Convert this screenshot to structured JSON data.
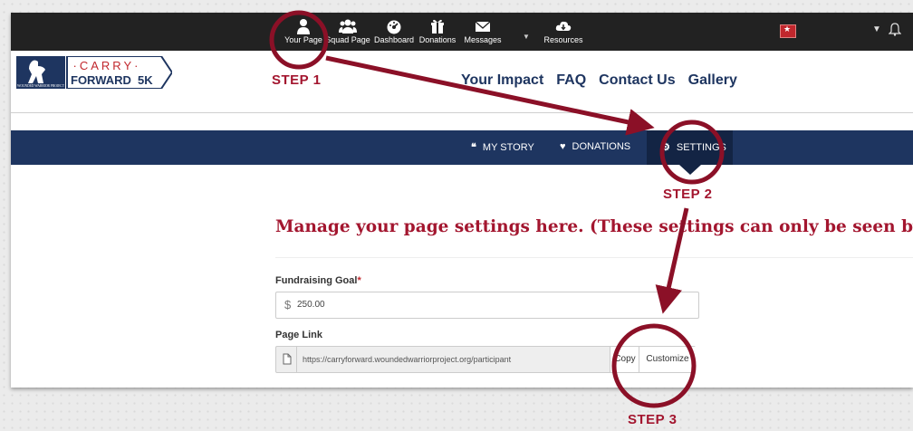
{
  "top_nav": {
    "items": [
      {
        "label": "Your Page",
        "icon": "person-icon"
      },
      {
        "label": "Squad Page",
        "icon": "group-icon"
      },
      {
        "label": "Dashboard",
        "icon": "dashboard-icon"
      },
      {
        "label": "Donations",
        "icon": "gift-icon"
      },
      {
        "label": "Messages",
        "icon": "envelope-icon"
      },
      {
        "label": "Resources",
        "icon": "cloud-download-icon"
      }
    ]
  },
  "brand": {
    "logo_top": "·CARRY·",
    "logo_bottom": "FORWARD",
    "logo_badge": "5K",
    "org_small": "WOUNDED WARRIOR PROJECT"
  },
  "main_nav": [
    "Your Impact",
    "FAQ",
    "Contact Us",
    "Gallery"
  ],
  "subnav": {
    "items": [
      {
        "label": "MY STORY",
        "icon": "quote-icon"
      },
      {
        "label": "DONATIONS",
        "icon": "heart-icon"
      },
      {
        "label": "SETTINGS",
        "icon": "gear-icon"
      }
    ],
    "active": "SETTINGS"
  },
  "content": {
    "heading": "Manage your page settings here. (These settings can only be seen by you.)",
    "goal_label": "Fundraising Goal",
    "goal_required": "*",
    "goal_currency": "$",
    "goal_value": "250.00",
    "link_label": "Page Link",
    "link_value": "https://carryforward.woundedwarriorproject.org/participant",
    "copy_label": "Copy",
    "customize_label": "Customize"
  },
  "steps": [
    "STEP 1",
    "STEP 2",
    "STEP 3"
  ],
  "colors": {
    "accent": "#a3162f",
    "navy": "#1e3560",
    "topbar": "#222222"
  }
}
